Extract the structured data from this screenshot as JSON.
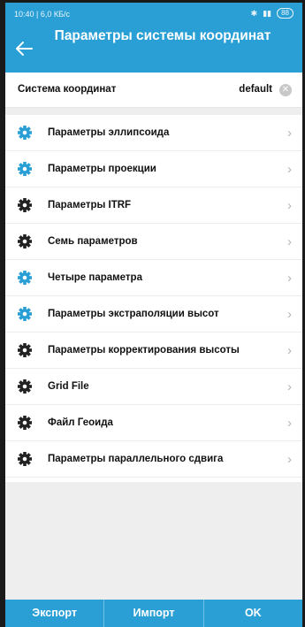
{
  "colors": {
    "accent": "#2a9fd6",
    "gear_blue": "#2a9fd6",
    "gear_dark": "#222222"
  },
  "status_bar": {
    "left": "10:40 | 6,0 КБ/с",
    "right_icons": [
      "bluetooth-icon",
      "signal-icon"
    ],
    "battery": "88"
  },
  "header": {
    "title": "Параметры системы координат",
    "back_icon": "arrow-left-icon"
  },
  "coord_system": {
    "label": "Система координат",
    "value": "default"
  },
  "items": [
    {
      "label": "Параметры эллипсоида",
      "icon": "gear-icon",
      "color": "#2a9fd6"
    },
    {
      "label": "Параметры проекции",
      "icon": "gear-icon",
      "color": "#2a9fd6"
    },
    {
      "label": "Параметры ITRF",
      "icon": "gear-icon",
      "color": "#222222"
    },
    {
      "label": "Семь параметров",
      "icon": "gear-icon",
      "color": "#222222"
    },
    {
      "label": "Четыре параметра",
      "icon": "gear-icon",
      "color": "#2a9fd6"
    },
    {
      "label": "Параметры экстраполяции высот",
      "icon": "gear-icon",
      "color": "#2a9fd6"
    },
    {
      "label": "Параметры корректирования высоты",
      "icon": "gear-icon",
      "color": "#222222"
    },
    {
      "label": "Grid File",
      "icon": "gear-icon",
      "color": "#222222"
    },
    {
      "label": "Файл Геоида",
      "icon": "gear-icon",
      "color": "#222222"
    },
    {
      "label": "Параметры параллельного сдвига",
      "icon": "gear-icon",
      "color": "#222222"
    }
  ],
  "footer": {
    "export": "Экспорт",
    "import": "Импорт",
    "ok": "OK"
  }
}
